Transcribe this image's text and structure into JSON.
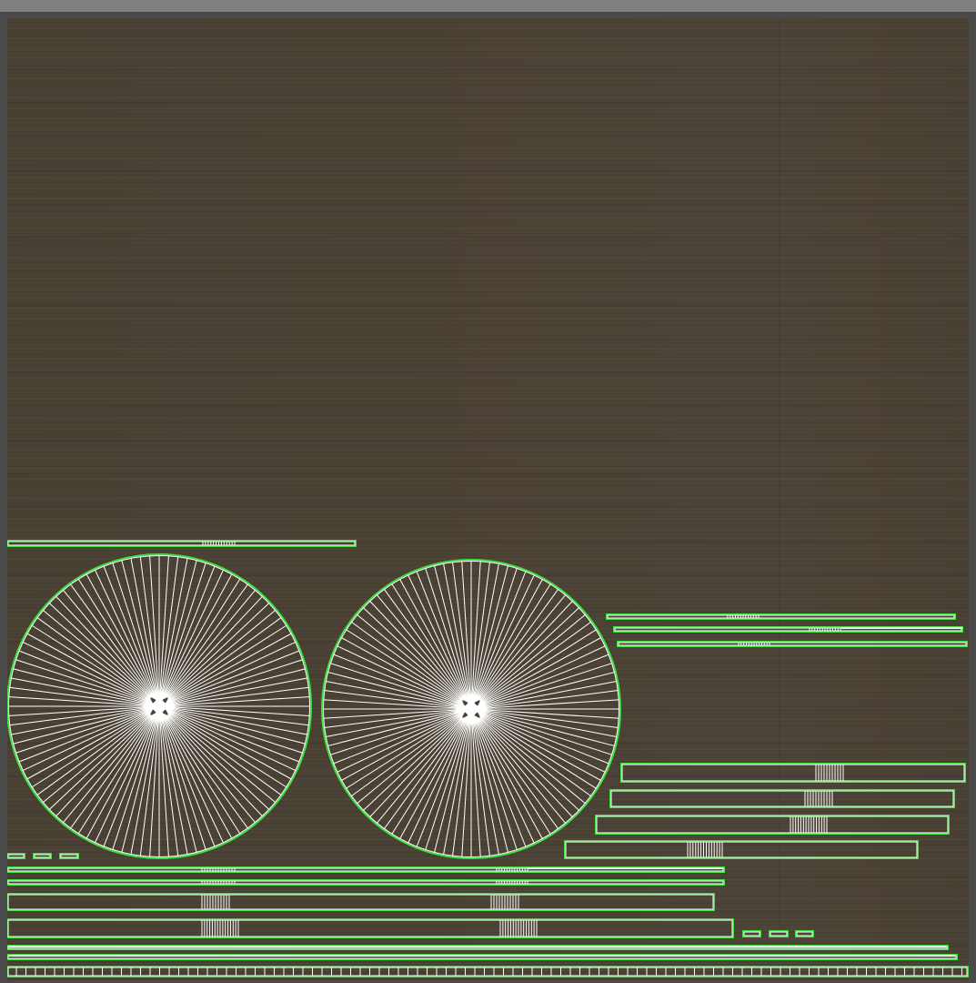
{
  "viewer": {
    "type": "uv-texture-layout-viewer",
    "texture": "dark-walnut-wood-grain",
    "colors": {
      "frame_bg": "#4a4a4a",
      "top_bar": "#808080",
      "wood_base": "#4b4235",
      "uv_shell_outline": "#3fe03f",
      "uv_wire": "#ffffff"
    }
  },
  "uv_layout": {
    "shell_count": 26,
    "shell_types": [
      "disc",
      "strip",
      "small-rect",
      "segmented-strip"
    ]
  }
}
